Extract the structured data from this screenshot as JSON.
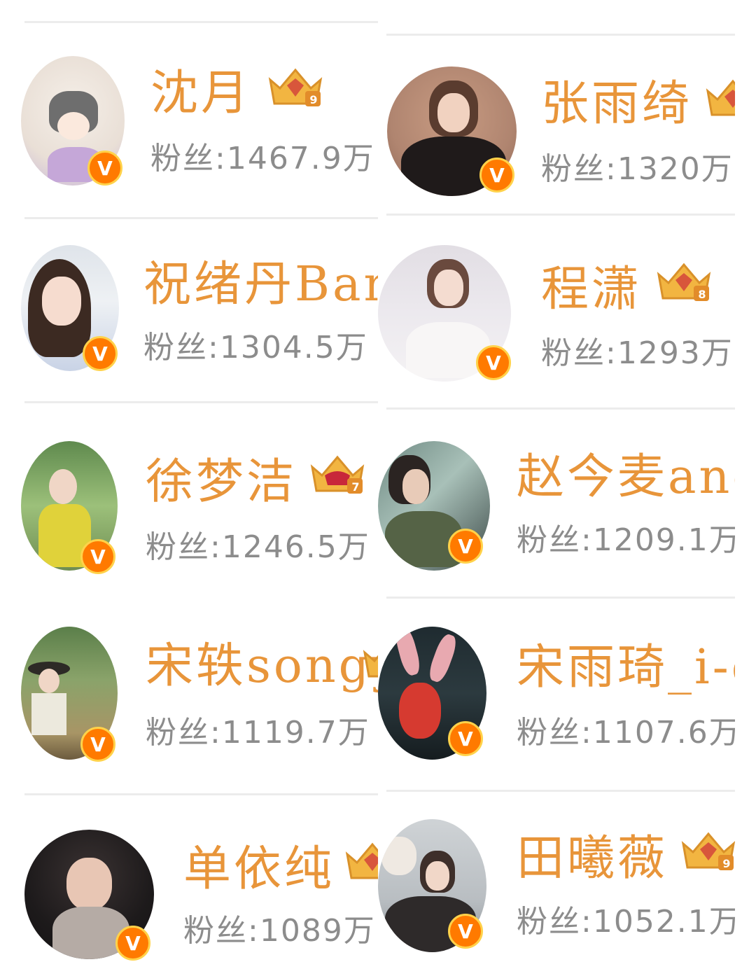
{
  "fans_prefix": "粉丝:",
  "accent_color": "#e8953a",
  "badge_color": "#ff7a00",
  "verified_badge_letter": "V",
  "accounts": [
    {
      "name": "沈月",
      "fans": "1467.9万",
      "level": "9",
      "crown": "diamond"
    },
    {
      "name": "张雨绮",
      "fans": "1320万",
      "level": "",
      "crown": "diamond"
    },
    {
      "name": "祝绪丹Bambi",
      "fans": "1304.5万",
      "level": "",
      "crown": ""
    },
    {
      "name": "程潇",
      "fans": "1293万",
      "level": "8",
      "crown": "diamond"
    },
    {
      "name": "徐梦洁",
      "fans": "1246.5万",
      "level": "7",
      "crown": "ruby"
    },
    {
      "name": "赵今麦ange",
      "fans": "1209.1万",
      "level": "",
      "crown": ""
    },
    {
      "name": "宋轶songyi",
      "fans": "1119.7万",
      "level": "",
      "crown": "diamond"
    },
    {
      "name": "宋雨琦_i-d",
      "fans": "1107.6万",
      "level": "",
      "crown": ""
    },
    {
      "name": "单依纯",
      "fans": "1089万",
      "level": "",
      "crown": "diamond"
    },
    {
      "name": "田曦薇",
      "fans": "1052.1万",
      "level": "9",
      "crown": "diamond"
    }
  ]
}
